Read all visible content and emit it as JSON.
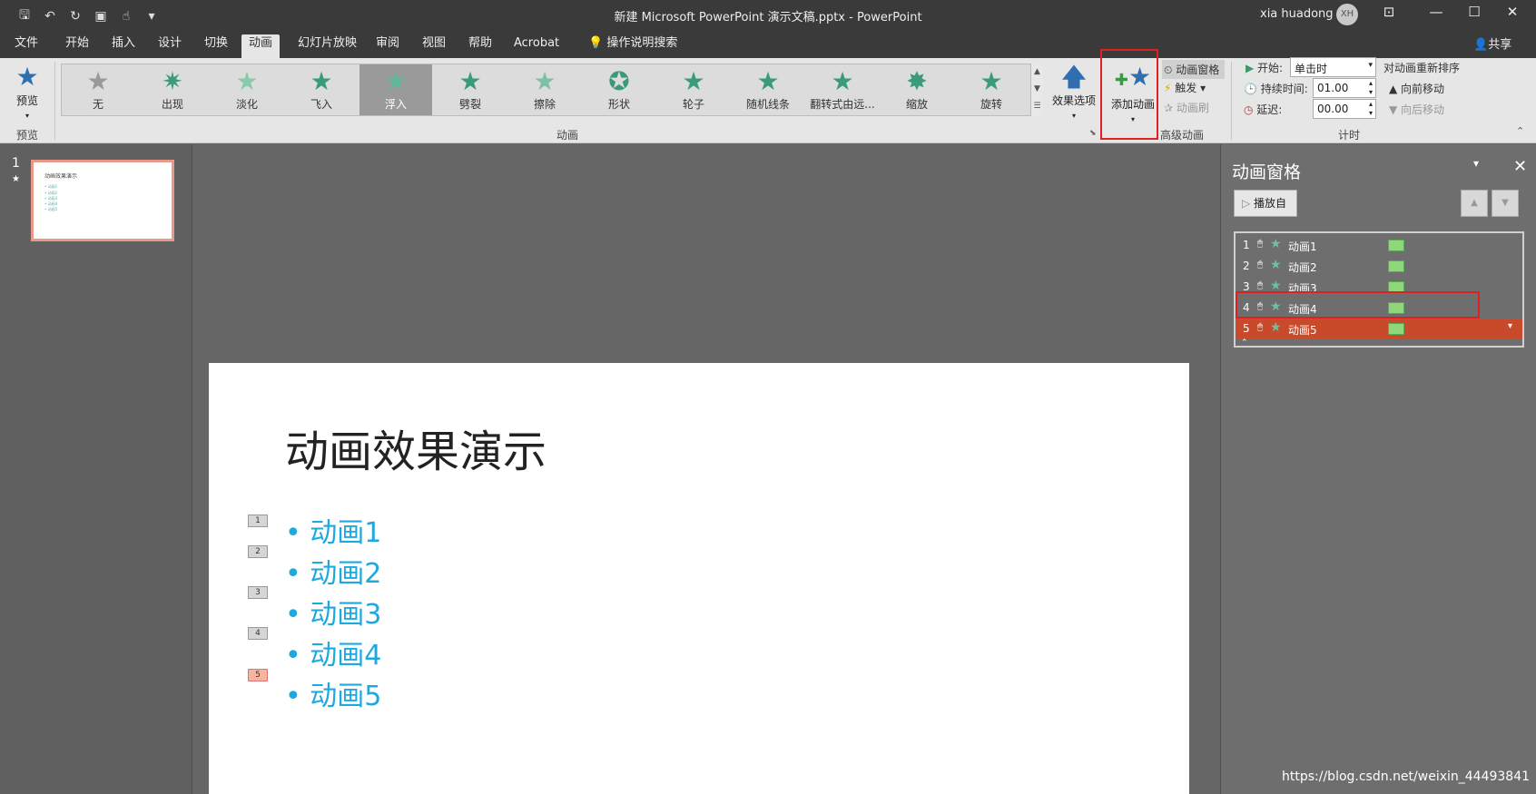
{
  "window": {
    "title": "新建 Microsoft PowerPoint 演示文稿.pptx  -  PowerPoint",
    "user": "xia huadong",
    "avatar": "XH"
  },
  "qat": [
    "save-icon",
    "undo-icon",
    "redo-icon",
    "present-icon",
    "touch-icon",
    "customize-icon"
  ],
  "menu": {
    "tabs": [
      "文件",
      "开始",
      "插入",
      "设计",
      "切换",
      "动画",
      "幻灯片放映",
      "审阅",
      "视图",
      "帮助",
      "Acrobat",
      "操作说明搜索"
    ],
    "active": "动画",
    "share": "共享"
  },
  "ribbon": {
    "preview": {
      "label": "预览",
      "group": "预览"
    },
    "gallery": [
      {
        "label": "无",
        "icon": "★"
      },
      {
        "label": "出现",
        "icon": "✷"
      },
      {
        "label": "淡化",
        "icon": "★"
      },
      {
        "label": "飞入",
        "icon": "★"
      },
      {
        "label": "浮入",
        "icon": "★"
      },
      {
        "label": "劈裂",
        "icon": "★"
      },
      {
        "label": "擦除",
        "icon": "★"
      },
      {
        "label": "形状",
        "icon": "✪"
      },
      {
        "label": "轮子",
        "icon": "★"
      },
      {
        "label": "随机线条",
        "icon": "★"
      },
      {
        "label": "翻转式由远...",
        "icon": "★"
      },
      {
        "label": "缩放",
        "icon": "✸"
      },
      {
        "label": "旋转",
        "icon": "★"
      }
    ],
    "gallery_selected": "浮入",
    "group_animation": "动画",
    "effect_options": "效果选项",
    "add_animation": "添加动画",
    "anim_pane_btn": "动画窗格",
    "trigger": "触发",
    "anim_painter": "动画刷",
    "group_advanced": "高级动画",
    "start_label": "开始:",
    "start_value": "单击时",
    "duration_label": "持续时间:",
    "duration_value": "01.00",
    "delay_label": "延迟:",
    "delay_value": "00.00",
    "reorder": "对动画重新排序",
    "move_earlier": "向前移动",
    "move_later": "向后移动",
    "group_timing": "计时"
  },
  "thumbs": {
    "number": "1",
    "star": "★",
    "title": "动画效果演示",
    "lines": [
      "• 动画1",
      "• 动画2",
      "• 动画3",
      "• 动画4",
      "• 动画5"
    ]
  },
  "slide": {
    "title": "动画效果演示",
    "bullets": [
      "• 动画1",
      "• 动画2",
      "• 动画3",
      "• 动画4",
      "• 动画5"
    ],
    "badges": [
      "1",
      "2",
      "3",
      "4",
      "5"
    ],
    "selected_badge": "5"
  },
  "anim_pane": {
    "title": "动画窗格",
    "play_from": "播放自",
    "items": [
      {
        "num": "1",
        "name": "动画1"
      },
      {
        "num": "2",
        "name": "动画2"
      },
      {
        "num": "3",
        "name": "动画3"
      },
      {
        "num": "4",
        "name": "动画4"
      },
      {
        "num": "5",
        "name": "动画5"
      }
    ],
    "selected": "5"
  },
  "watermark": "https://blog.csdn.net/weixin_44493841"
}
